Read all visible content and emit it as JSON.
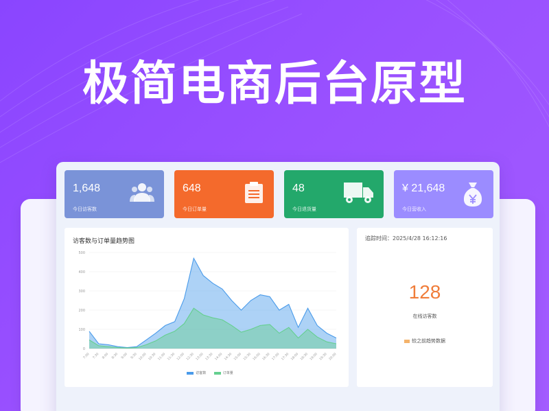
{
  "hero": {
    "title": "极简电商后台原型"
  },
  "stats": [
    {
      "value": "1,648",
      "label": "今日访客数",
      "color": "#7a93d8",
      "icon": "users-icon"
    },
    {
      "value": "648",
      "label": "今日订单量",
      "color": "#f46a2c",
      "icon": "clipboard-icon"
    },
    {
      "value": "48",
      "label": "今日退货量",
      "color": "#23a86b",
      "icon": "truck-icon"
    },
    {
      "value": "¥ 21,648",
      "label": "今日营收入",
      "color": "#9b8cff",
      "icon": "money-bag-icon"
    }
  ],
  "chart_panel": {
    "title": "访客数与订单量趋势图"
  },
  "side_panel": {
    "updated_time": "追踪时间：2025/4/28 16:12:16",
    "big_number": "128",
    "caption": "在线访客数",
    "legend": "较之前趋势数据"
  },
  "chart_data": {
    "type": "area",
    "title": "访客数与订单量趋势图",
    "x": [
      "7:00",
      "7:30",
      "8:00",
      "8:30",
      "9:00",
      "9:30",
      "10:00",
      "10:30",
      "11:00",
      "11:30",
      "12:00",
      "12:30",
      "13:00",
      "13:30",
      "14:00",
      "14:30",
      "15:00",
      "15:30",
      "16:00",
      "16:30",
      "17:00",
      "17:30",
      "18:00",
      "18:30",
      "19:00",
      "19:30",
      "20:00"
    ],
    "ylim": [
      0,
      500
    ],
    "yticks": [
      0,
      100,
      200,
      300,
      400,
      500
    ],
    "series": [
      {
        "name": "访客数",
        "color": "#4a9bea",
        "values": [
          90,
          25,
          20,
          10,
          5,
          10,
          45,
          80,
          120,
          140,
          260,
          470,
          380,
          340,
          310,
          250,
          200,
          250,
          280,
          270,
          200,
          230,
          110,
          210,
          120,
          80,
          55
        ]
      },
      {
        "name": "订单量",
        "color": "#65cf8f",
        "values": [
          45,
          15,
          10,
          5,
          3,
          5,
          20,
          40,
          70,
          90,
          130,
          210,
          175,
          160,
          150,
          120,
          85,
          100,
          120,
          125,
          80,
          110,
          55,
          100,
          60,
          35,
          25
        ]
      }
    ]
  }
}
